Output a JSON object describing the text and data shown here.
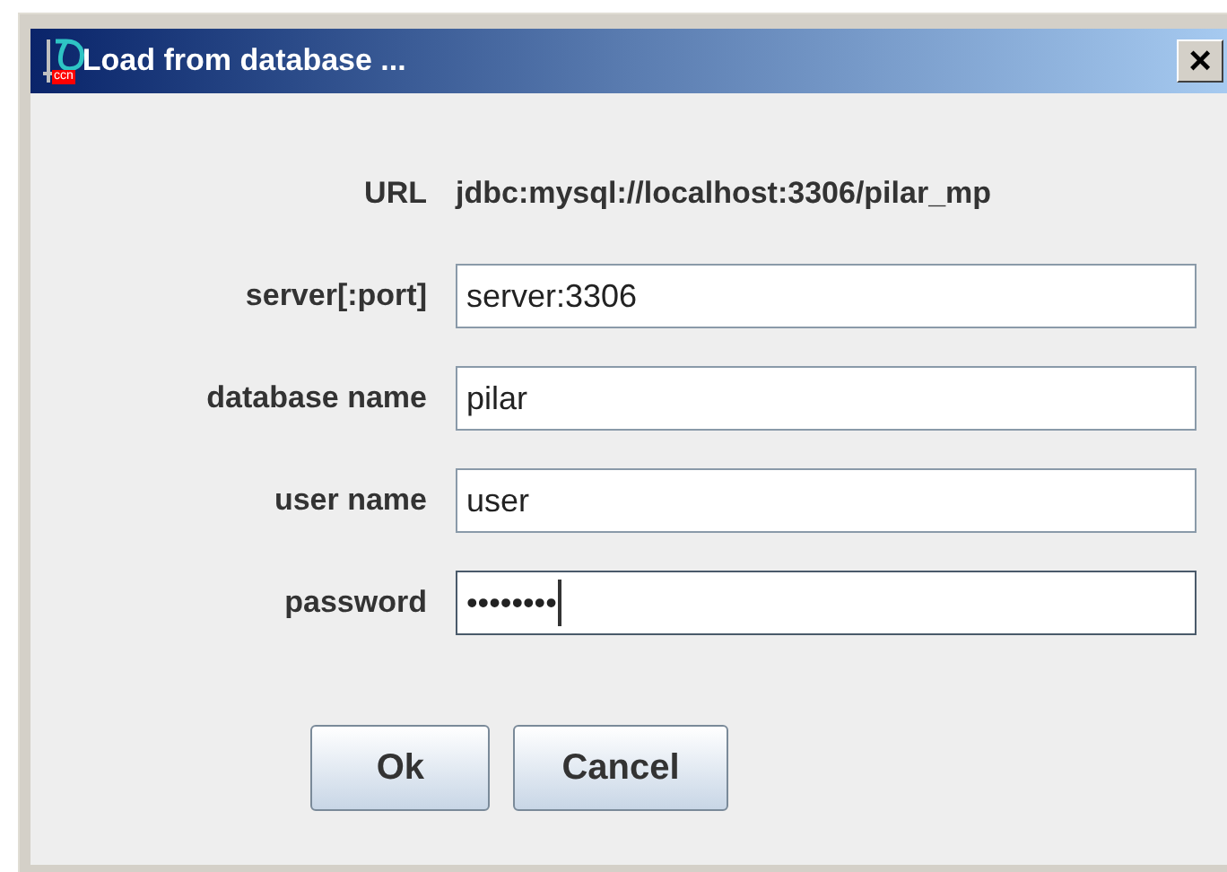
{
  "window": {
    "title": "Load from database ...",
    "icon_badge": "ccn",
    "close": "×"
  },
  "url": {
    "label": "URL",
    "value": "jdbc:mysql://localhost:3306/pilar_mp"
  },
  "fields": [
    {
      "label": "server[:port]",
      "value": "server:3306",
      "focused": false
    },
    {
      "label": "database name",
      "value": "pilar",
      "focused": false
    },
    {
      "label": "user name",
      "value": "user",
      "focused": false
    },
    {
      "label": "password",
      "value": "••••••••",
      "focused": true
    }
  ],
  "buttons": [
    "Ok",
    "Cancel"
  ]
}
